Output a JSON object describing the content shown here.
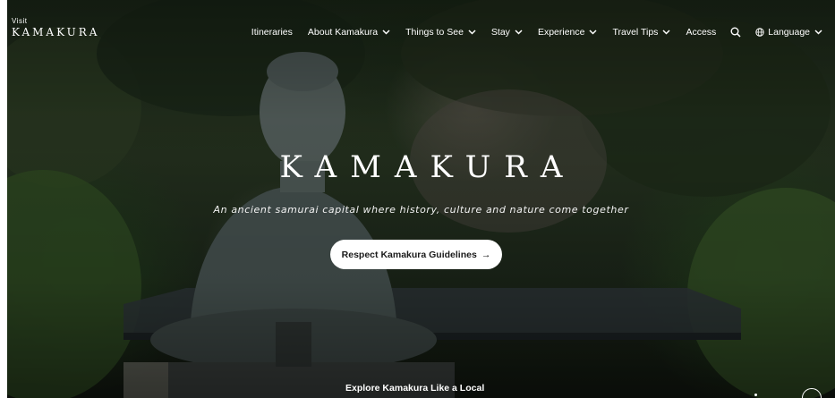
{
  "header": {
    "logo_small": "Visit",
    "logo_big": "KAMAKURA",
    "nav": [
      {
        "label": "Itineraries",
        "dropdown": false
      },
      {
        "label": "About Kamakura",
        "dropdown": true
      },
      {
        "label": "Things to See",
        "dropdown": true
      },
      {
        "label": "Stay",
        "dropdown": true
      },
      {
        "label": "Experience",
        "dropdown": true
      },
      {
        "label": "Travel Tips",
        "dropdown": true
      },
      {
        "label": "Access",
        "dropdown": false
      }
    ],
    "search_icon": "search-icon",
    "language_label": "Language",
    "language_icon": "globe-icon"
  },
  "hero": {
    "title": "KAMAKURA",
    "subtitle": "An ancient samurai capital where history, culture and nature come together",
    "cta_label": "Respect Kamakura Guidelines",
    "cta_arrow": "→",
    "bottom_link": "Explore Kamakura Like a Local",
    "play_icon": "play-icon"
  },
  "colors": {
    "text": "#ffffff",
    "cta_bg": "#ffffff",
    "cta_text": "#1a1a1a"
  }
}
